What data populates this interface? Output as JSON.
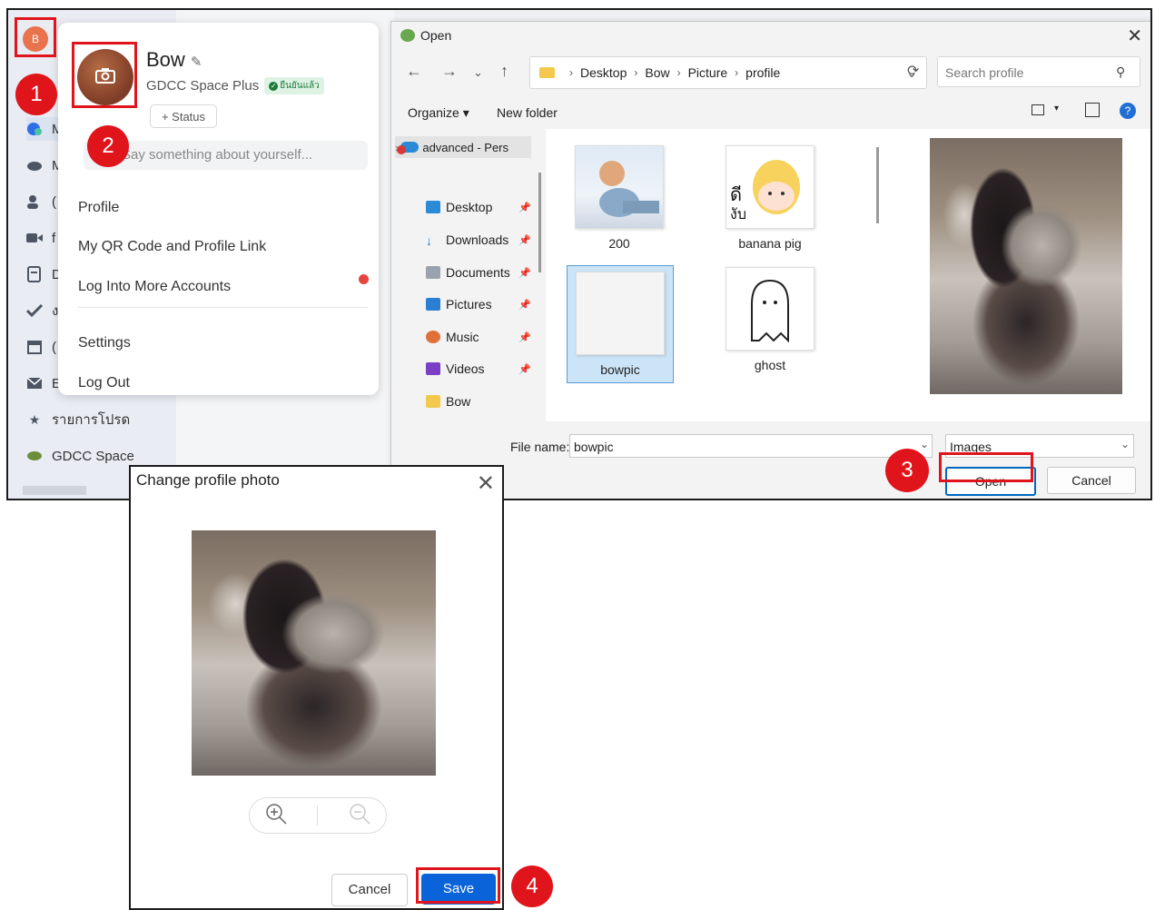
{
  "sidebar": {
    "avatar_letter": "B",
    "items": [
      {
        "icon": "chat-icon",
        "label": "M"
      },
      {
        "icon": "cloud-icon",
        "label": "M"
      },
      {
        "icon": "contacts-icon",
        "label": "("
      },
      {
        "icon": "video-icon",
        "label": "f"
      },
      {
        "icon": "docs-icon",
        "label": "D"
      },
      {
        "icon": "tasks-icon",
        "label": "ง"
      },
      {
        "icon": "calendar-icon",
        "label": "("
      },
      {
        "icon": "mail-icon",
        "label": "E"
      }
    ],
    "favorites_label": "รายการโปรด",
    "space_label": "GDCC Space"
  },
  "profile_popover": {
    "name": "Bow",
    "plan": "GDCC Space Plus",
    "verified_label": "ยืนยันแล้ว",
    "status_button": "+ Status",
    "about_placeholder": "Say something about yourself...",
    "menu": {
      "profile": "Profile",
      "qr": "My QR Code and Profile Link",
      "more_accounts": "Log Into More Accounts",
      "settings": "Settings",
      "logout": "Log Out"
    }
  },
  "steps": [
    "1",
    "2",
    "3",
    "4"
  ],
  "file_dialog": {
    "title": "Open",
    "breadcrumb": [
      "Desktop",
      "Bow",
      "Picture",
      "profile"
    ],
    "search_placeholder": "Search profile",
    "organize": "Organize",
    "new_folder": "New folder",
    "nav_cloud": "advanced - Pers",
    "nav_items": [
      "Desktop",
      "Downloads",
      "Documents",
      "Pictures",
      "Music",
      "Videos",
      "Bow"
    ],
    "files": [
      {
        "name": "200"
      },
      {
        "name": "banana pig"
      },
      {
        "name": "bowpic",
        "selected": true
      },
      {
        "name": "ghost"
      }
    ],
    "file_name_label": "File name:",
    "file_name_value": "bowpic",
    "filter": "Images",
    "open_button": "Open",
    "cancel_button": "Cancel"
  },
  "change_photo": {
    "title": "Change profile photo",
    "cancel_button": "Cancel",
    "save_button": "Save"
  },
  "colors": {
    "accent_red": "#e0141b",
    "save_blue": "#0a63d8",
    "avatar": "#e8734d"
  }
}
